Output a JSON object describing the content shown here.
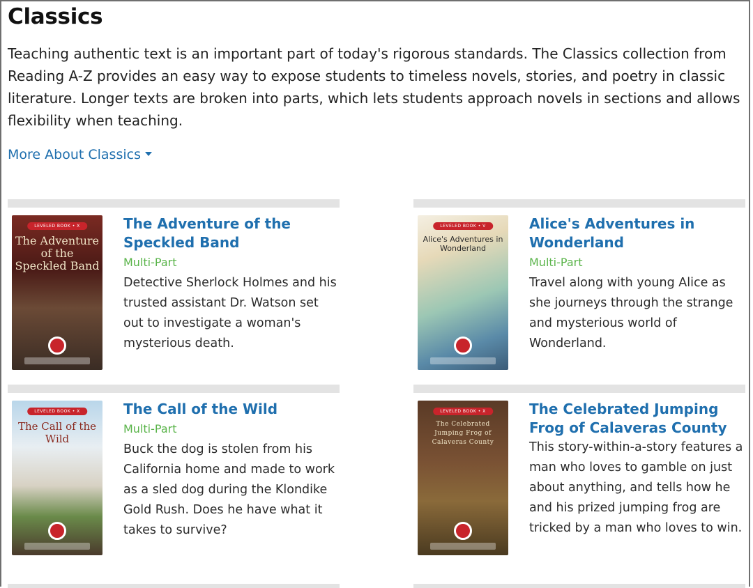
{
  "page": {
    "title": "Classics",
    "intro": "Teaching authentic text is an important part of today's rigorous standards. The Classics collection from Reading A-Z provides an easy way to expose students to timeless novels, stories, and poetry in classic literature. Longer texts are broken into parts, which lets students approach novels in sections and allows flexibility when teaching.",
    "more_link": "More About Classics"
  },
  "colors": {
    "link": "#1f6fae",
    "tag": "#5ab44a",
    "divider": "#e3e3e3"
  },
  "books": [
    {
      "title": "The Adventure of the Speckled Band",
      "tag": "Multi-Part",
      "description": "Detective Sherlock Holmes and his trusted assistant Dr. Watson set out to investigate a woman's mysterious death.",
      "cover": {
        "title": "The Adventure of the Speckled Band",
        "badge": "LEVELED BOOK • X"
      }
    },
    {
      "title": "Alice's Adventures in Wonderland",
      "tag": "Multi-Part",
      "description": "Travel along with young Alice as she journeys through the strange and mysterious world of Wonderland.",
      "cover": {
        "title": "Alice's Adventures in Wonderland",
        "badge": "LEVELED BOOK • V"
      }
    },
    {
      "title": "The Call of the Wild",
      "tag": "Multi-Part",
      "description": "Buck the dog is stolen from his California home and made to work as a sled dog during the Klondike Gold Rush. Does he have what it takes to survive?",
      "cover": {
        "title": "The Call of the Wild",
        "badge": "LEVELED BOOK • X"
      }
    },
    {
      "title": "The Celebrated Jumping Frog of Calaveras County",
      "tag": "",
      "description": "This story-within-a-story features a man who loves to gamble on just about anything, and tells how he and his prized jumping frog are tricked by a man who loves to win.",
      "cover": {
        "title": "The Celebrated Jumping Frog of Calaveras County",
        "badge": "LEVELED BOOK • X"
      }
    }
  ]
}
